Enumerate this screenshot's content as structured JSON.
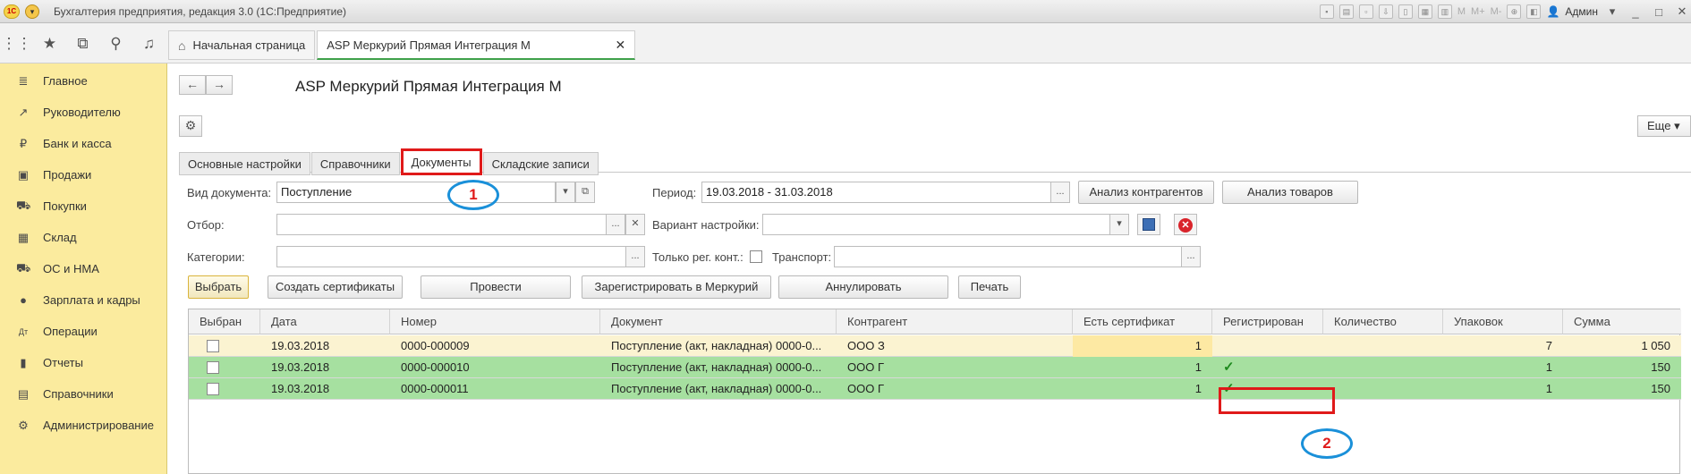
{
  "window": {
    "title": "Бухгалтерия предприятия, редакция 3.0  (1С:Предприятие)",
    "logo_text": "1С",
    "toolbar_text": [
      "M",
      "M+",
      "M-"
    ],
    "user": "Админ"
  },
  "top_tabs": [
    {
      "label": "Начальная страница"
    },
    {
      "label": "ASP Меркурий Прямая Интеграция М"
    }
  ],
  "sidebar": {
    "items": [
      {
        "label": "Главное",
        "icon": "≣"
      },
      {
        "label": "Руководителю",
        "icon": "↗"
      },
      {
        "label": "Банк и касса",
        "icon": "₽"
      },
      {
        "label": "Продажи",
        "icon": "▣"
      },
      {
        "label": "Покупки",
        "icon": "⛟"
      },
      {
        "label": "Склад",
        "icon": "▦"
      },
      {
        "label": "ОС и НМА",
        "icon": "⛟"
      },
      {
        "label": "Зарплата и кадры",
        "icon": "●"
      },
      {
        "label": "Операции",
        "icon": "Дт"
      },
      {
        "label": "Отчеты",
        "icon": "▮"
      },
      {
        "label": "Справочники",
        "icon": "▤"
      },
      {
        "label": "Администрирование",
        "icon": "⚙"
      }
    ]
  },
  "page": {
    "title": "ASP Меркурий Прямая Интеграция М",
    "more_label": "Еще",
    "tabs": [
      {
        "label": "Основные настройки"
      },
      {
        "label": "Справочники"
      },
      {
        "label": "Документы"
      },
      {
        "label": "Складские записи"
      }
    ]
  },
  "filters": {
    "doc_type_label": "Вид документа:",
    "doc_type_value": "Поступление",
    "period_label": "Период:",
    "period_value": "19.03.2018 - 31.03.2018",
    "analysis_counterparties": "Анализ контрагентов",
    "analysis_goods": "Анализ товаров",
    "filter_label": "Отбор:",
    "filter_value": "",
    "variant_label": "Вариант настройки:",
    "variant_value": "",
    "categories_label": "Категории:",
    "categories_value": "",
    "only_reg_label": "Только рег. конт.:",
    "transport_label": "Транспорт:",
    "transport_value": ""
  },
  "actions": {
    "select": "Выбрать",
    "create_certs": "Создать сертификаты",
    "post": "Провести",
    "register": "Зарегистрировать в Меркурий",
    "cancel": "Аннулировать",
    "print": "Печать"
  },
  "table": {
    "columns": [
      "Выбран",
      "Дата",
      "Номер",
      "Документ",
      "Контрагент",
      "Есть сертификат",
      "Регистрирован",
      "Количество",
      "Упаковок",
      "Сумма"
    ],
    "rows": [
      {
        "date": "19.03.2018",
        "number": "0000-000009",
        "doc": "Поступление (акт, накладная) 0000-0...",
        "counterparty": "ООО  З",
        "has_cert": "1",
        "registered": false,
        "qty": "",
        "packs": "7",
        "sum": "1 050"
      },
      {
        "date": "19.03.2018",
        "number": "0000-000010",
        "doc": "Поступление (акт, накладная) 0000-0...",
        "counterparty": "ООО  Г",
        "has_cert": "1",
        "registered": true,
        "qty": "",
        "packs": "1",
        "sum": "150"
      },
      {
        "date": "19.03.2018",
        "number": "0000-000011",
        "doc": "Поступление (акт, накладная) 0000-0...",
        "counterparty": "ООО  Г",
        "has_cert": "1",
        "registered": true,
        "qty": "",
        "packs": "1",
        "sum": "150"
      }
    ]
  },
  "annotations": {
    "one": "1",
    "two": "2",
    "colors": {
      "rect": "#e01a1a",
      "oval": "#1a90d9"
    }
  },
  "colors": {
    "sidebar_bg": "#fbeb9e",
    "row_yellow": "#fbf3d1",
    "row_green": "#a6e0a0",
    "tab_accent": "#3fa14a"
  }
}
